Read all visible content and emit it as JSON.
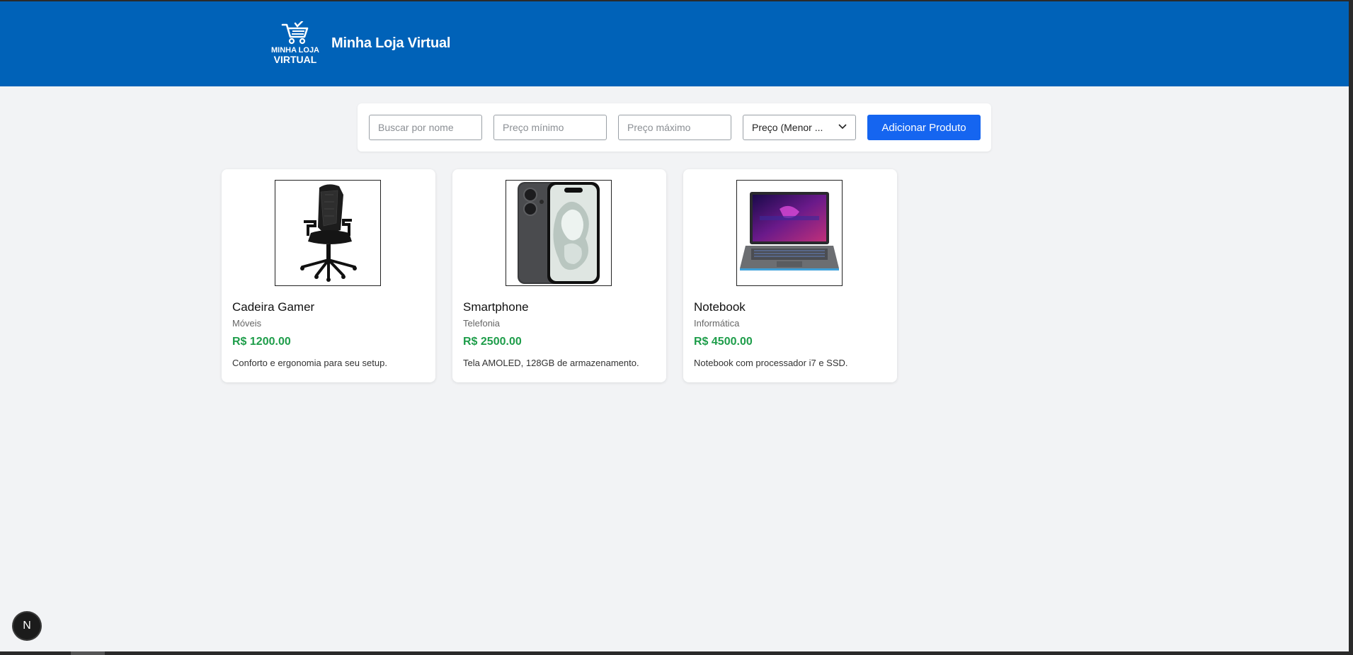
{
  "header": {
    "logo_line1": "MINHA LOJA",
    "logo_line2": "VIRTUAL",
    "title": "Minha Loja Virtual",
    "logo_icon": "cart-icon"
  },
  "filters": {
    "search_placeholder": "Buscar por nome",
    "min_price_placeholder": "Preço mínimo",
    "max_price_placeholder": "Preço máximo",
    "sort_selected": "Preço (Menor ...",
    "add_button": "Adicionar Produto"
  },
  "products": [
    {
      "name": "Cadeira Gamer",
      "category": "Móveis",
      "price": "R$ 1200.00",
      "description": "Conforto e ergonomia para seu setup.",
      "image_icon": "gaming-chair-image"
    },
    {
      "name": "Smartphone",
      "category": "Telefonia",
      "price": "R$ 2500.00",
      "description": "Tela AMOLED, 128GB de armazenamento.",
      "image_icon": "smartphone-image"
    },
    {
      "name": "Notebook",
      "category": "Informática",
      "price": "R$ 4500.00",
      "description": "Notebook com processador i7 e SSD.",
      "image_icon": "laptop-image"
    }
  ],
  "dev_badge": "N",
  "colors": {
    "header_bg": "#0062b8",
    "page_bg": "#f2f3f5",
    "button_bg": "#1565f0",
    "price": "#1e9d4a"
  }
}
